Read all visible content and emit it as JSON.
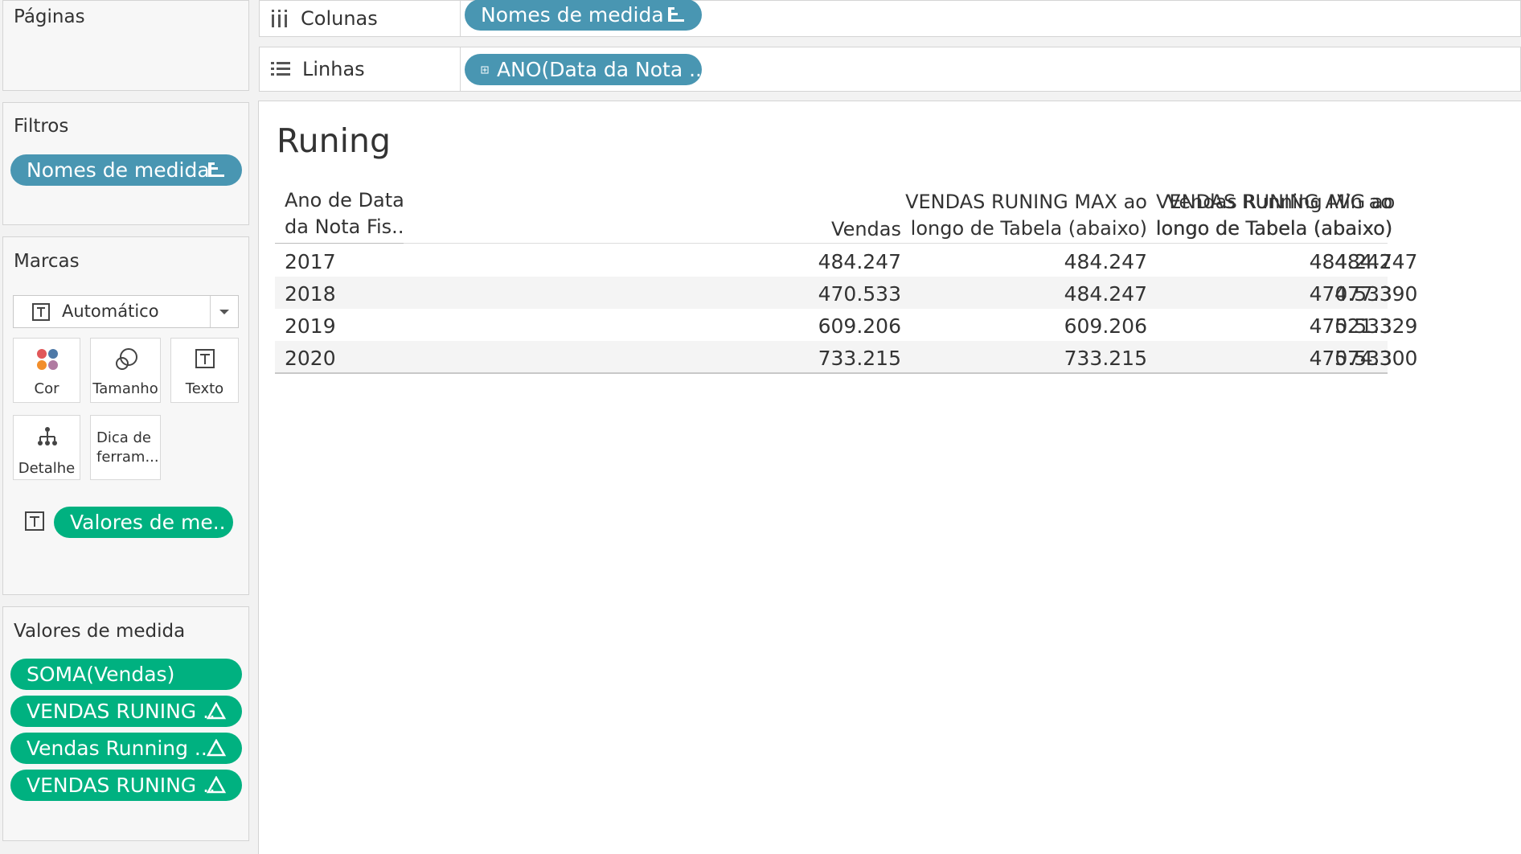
{
  "side": {
    "pages_title": "Páginas",
    "filters_title": "Filtros",
    "filter_pill": "Nomes de medida",
    "marks_title": "Marcas",
    "mark_type": "Automático",
    "cards": {
      "color": "Cor",
      "size": "Tamanho",
      "text": "Texto",
      "detail": "Detalhe",
      "tooltip_line1": "Dica de",
      "tooltip_line2": "ferram..."
    },
    "text_pill": "Valores de me..",
    "measure_values_title": "Valores de medida",
    "measure_pills": [
      "SOMA(Vendas)",
      "VENDAS RUNING ..",
      "Vendas Running ..",
      "VENDAS RUNING .."
    ]
  },
  "shelves": {
    "columns_label": "Colunas",
    "columns_pill": "Nomes de medida",
    "rows_label": "Linhas",
    "rows_pill": "ANO(Data da Nota .."
  },
  "view": {
    "title": "Runing",
    "headers": {
      "year_line1": "Ano de Data",
      "year_line2": "da Nota Fis..",
      "vendas": "Vendas",
      "max_line1": "VENDAS RUNING MAX ao",
      "max_line2": "longo de Tabela (abaixo)",
      "min_line1": "Vendas Running Min ao",
      "min_line2": "longo de Tabela (abaixo)",
      "avg_line1": "VENDAS RUNING AVG ao",
      "avg_line2": "longo de Tabela (abaixo)"
    },
    "rows": [
      {
        "year": "2017",
        "vendas": "484.247",
        "max": "484.247",
        "min": "484.247",
        "avg": "484.247"
      },
      {
        "year": "2018",
        "vendas": "470.533",
        "max": "484.247",
        "min": "470.533",
        "avg": "477.390"
      },
      {
        "year": "2019",
        "vendas": "609.206",
        "max": "609.206",
        "min": "470.533",
        "avg": "521.329"
      },
      {
        "year": "2020",
        "vendas": "733.215",
        "max": "733.215",
        "min": "470.533",
        "avg": "574.300"
      }
    ]
  },
  "colors": {
    "blue_pill": "#4996b2",
    "green_pill": "#00b180"
  }
}
